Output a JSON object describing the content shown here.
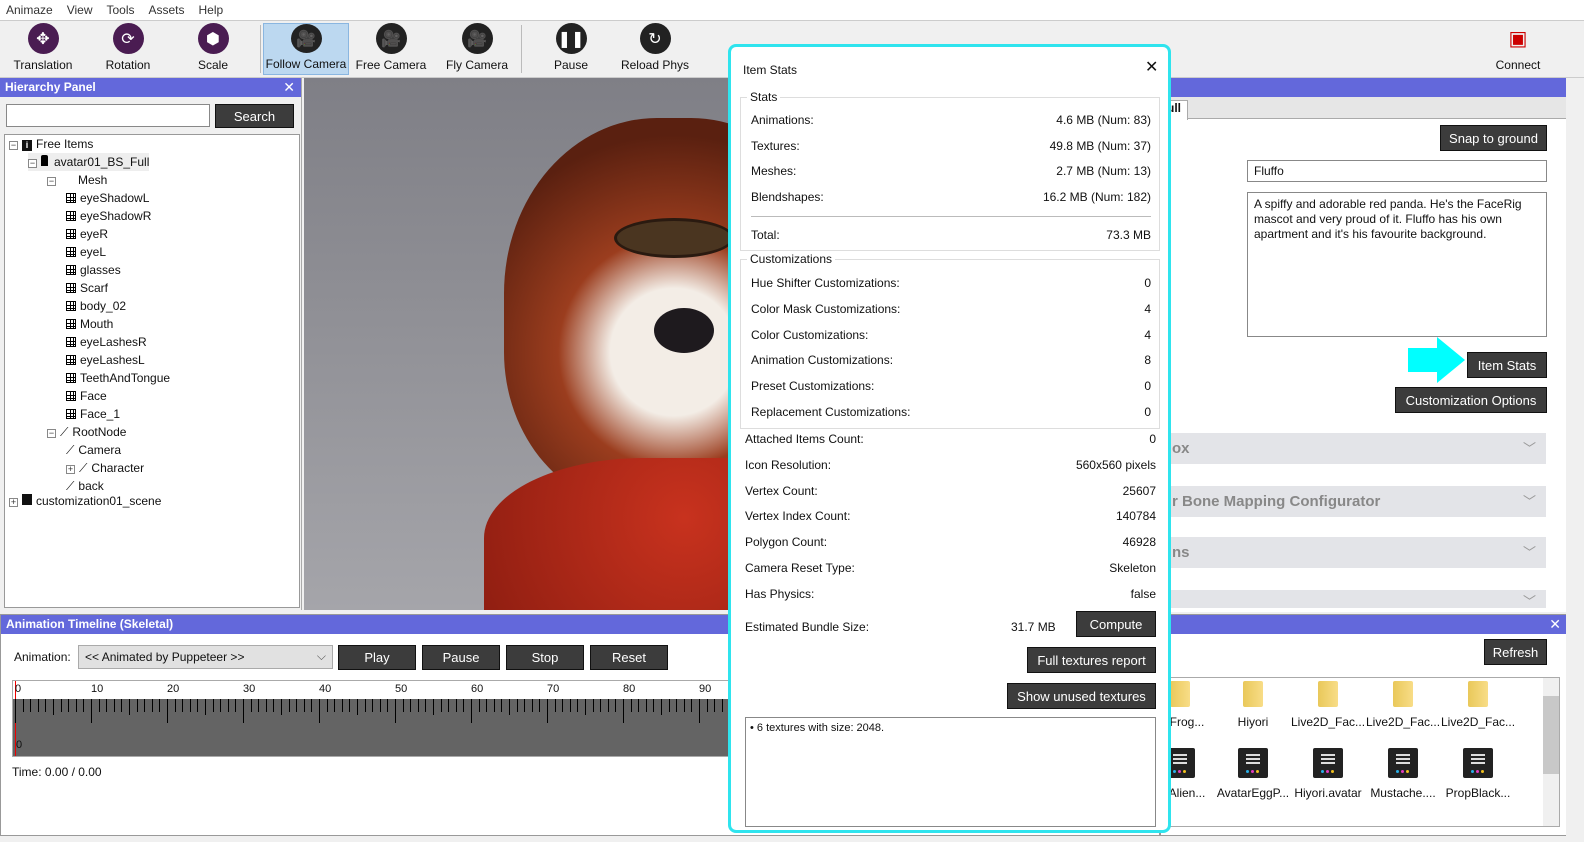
{
  "menu": [
    "Animaze",
    "View",
    "Tools",
    "Assets",
    "Help"
  ],
  "toolbar": {
    "tools": [
      "Translation",
      "Rotation",
      "Scale",
      "Follow Camera",
      "Free Camera",
      "Fly Camera",
      "Pause",
      "Reload Phys"
    ],
    "connect": "Connect",
    "selected": "Follow Camera"
  },
  "hierarchy": {
    "title": "Hierarchy Panel",
    "search_value": "",
    "search_button": "Search",
    "nodes": [
      "Free Items",
      "avatar01_BS_Full",
      "Mesh",
      "eyeShadowL",
      "eyeShadowR",
      "eyeR",
      "eyeL",
      "glasses",
      "Scarf",
      "body_02",
      "Mouth",
      "eyeLashesR",
      "eyeLashesL",
      "TeethAndTongue",
      "Face",
      "Face_1",
      "RootNode",
      "Camera",
      "Character",
      "back",
      "customization01_scene"
    ]
  },
  "timeline": {
    "title": "Animation Timeline (Skeletal)",
    "animation_label": "Animation:",
    "animation_value": "<< Animated by Puppeteer >>",
    "buttons": [
      "Play",
      "Pause",
      "Stop",
      "Reset"
    ],
    "ticks": [
      "0",
      "10",
      "20",
      "30",
      "40",
      "50",
      "60",
      "70",
      "80",
      "90"
    ],
    "bottom_marker": "0",
    "time": "Time: 0.00 / 0.00"
  },
  "dialog": {
    "title": "Item Stats",
    "stats": {
      "title": "Stats",
      "rows": [
        [
          "Animations:",
          "4.6 MB (Num: 83)"
        ],
        [
          "Textures:",
          "49.8 MB (Num: 37)"
        ],
        [
          "Meshes:",
          "2.7 MB (Num: 13)"
        ],
        [
          "Blendshapes:",
          "16.2 MB (Num: 182)"
        ]
      ],
      "total": [
        "Total:",
        "73.3 MB"
      ]
    },
    "customizations": {
      "title": "Customizations",
      "rows": [
        [
          "Hue Shifter Customizations:",
          "0"
        ],
        [
          "Color Mask Customizations:",
          "4"
        ],
        [
          "Color Customizations:",
          "4"
        ],
        [
          "Animation Customizations:",
          "8"
        ],
        [
          "Preset Customizations:",
          "0"
        ],
        [
          "Replacement Customizations:",
          "0"
        ]
      ]
    },
    "info": [
      [
        "Attached Items Count:",
        "0"
      ],
      [
        "Icon Resolution:",
        "560x560 pixels"
      ],
      [
        "Vertex Count:",
        "25607"
      ],
      [
        "Vertex Index Count:",
        "140784"
      ],
      [
        "Polygon Count:",
        "46928"
      ],
      [
        "Camera Reset Type:",
        "Skeleton"
      ],
      [
        "Has Physics:",
        "false"
      ]
    ],
    "bundle": {
      "label": "Estimated Bundle Size:",
      "value": "31.7 MB",
      "compute": "Compute"
    },
    "full_textures": "Full textures report",
    "unused_textures": "Show unused textures",
    "log": "• 6 textures with size: 2048."
  },
  "properties": {
    "tab": "ull",
    "snap": "Snap to ground",
    "name": "Fluffo",
    "description": "A spiffy and adorable red panda. He's the FaceRig mascot and very proud of it. Fluffo has his own apartment and it's his favourite background.",
    "item_stats": "Item Stats",
    "customization_options": "Customization Options",
    "sections": [
      "ox",
      "r Bone Mapping Configurator",
      "ns",
      ""
    ]
  },
  "assets": {
    "refresh": "Refresh",
    "folders": [
      "tarFrog...",
      "Hiyori",
      "Live2D_Fac...",
      "Live2D_Fac...",
      "Live2D_Fac..."
    ],
    "files": [
      "tarAlien...",
      "AvatarEggP...",
      "Hiyori.avatar",
      "Mustache....",
      "PropBlack..."
    ]
  },
  "colors": {
    "panel_header": "#6368db",
    "highlight": "#2fe4ee",
    "button": "#3c3c3c"
  }
}
